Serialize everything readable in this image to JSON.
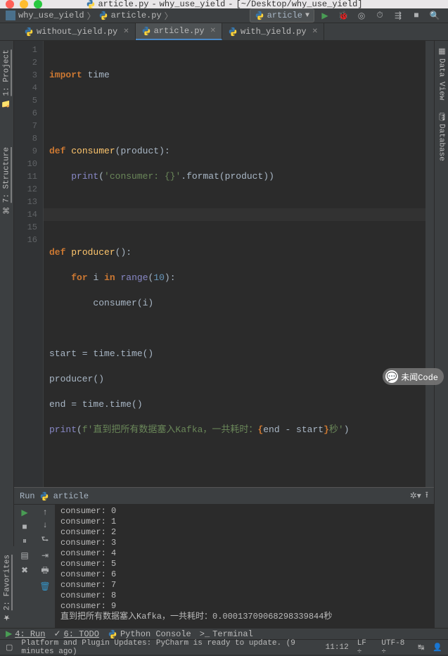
{
  "titlebar": {
    "file": "article.py",
    "project": "why_use_yield",
    "path": "[~/Desktop/why_use_yield]"
  },
  "breadcrumb": {
    "folder": "why_use_yield",
    "file": "article.py"
  },
  "run_config": {
    "name": "article"
  },
  "tabs": [
    {
      "name": "without_yield.py",
      "active": false
    },
    {
      "name": "article.py",
      "active": true
    },
    {
      "name": "with_yield.py",
      "active": false
    }
  ],
  "left_tool_tabs": {
    "project": "1: Project",
    "structure": "7: Structure",
    "favorites": "2: Favorites"
  },
  "right_tool_tabs": {
    "dataview": "Data View",
    "database": "Database"
  },
  "code": {
    "lines": [
      1,
      2,
      3,
      4,
      5,
      6,
      7,
      8,
      9,
      10,
      11,
      12,
      13,
      14,
      15,
      16
    ],
    "l1_kw": "import",
    "l1_mod": "time",
    "l4_kw": "def",
    "l4_fn": "consumer",
    "l4_param": "product",
    "l5_fn": "print",
    "l5_str1": "'consumer: {}'",
    "l5_m": ".format(product))",
    "l8_kw": "def",
    "l8_fn": "producer",
    "l9_for": "for",
    "l9_i": "i",
    "l9_in": "in",
    "l9_range": "range",
    "l9_n": "10",
    "l10_call": "consumer(i)",
    "l12": "start = time.time()",
    "l13": "producer()",
    "l14": "end = time.time()",
    "l15_fn": "print",
    "l15_p": "(",
    "l15_f": "f'直到把所有数据塞入Kafka，一共耗时：",
    "l15_b1": "{",
    "l15_expr": "end - start",
    "l15_b2": "}",
    "l15_suf": "秒'",
    "l15_cp": ")"
  },
  "run_panel": {
    "title": "Run",
    "config": "article",
    "output": [
      "consumer: 0",
      "consumer: 1",
      "consumer: 2",
      "consumer: 3",
      "consumer: 4",
      "consumer: 5",
      "consumer: 6",
      "consumer: 7",
      "consumer: 8",
      "consumer: 9",
      "直到把所有数据塞入Kafka，一共耗时：0.00013709068298339844秒"
    ]
  },
  "bottom_tools": {
    "run": "4: Run",
    "todo": "6: TODO",
    "pyconsole": "Python Console",
    "terminal": "Terminal"
  },
  "status": {
    "msg": "Platform and Plugin Updates: PyCharm is ready to update. (9 minutes ago)",
    "pos": "11:12",
    "lf": "LF",
    "enc": "UTF-8",
    "ind": "↹"
  },
  "wechat": "未闻Code"
}
